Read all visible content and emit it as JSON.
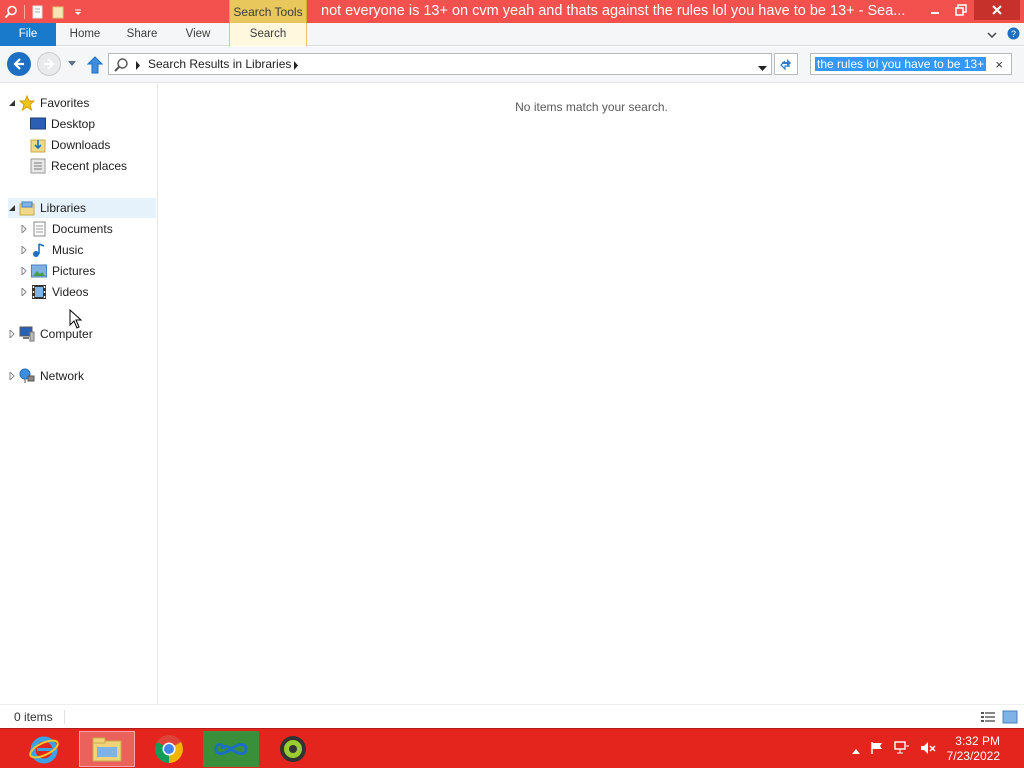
{
  "titlebar": {
    "title": "not everyone is 13+ on cvm yeah and thats against the rules lol you have to be 13+ - Sea...",
    "context_tab_group": "Search Tools"
  },
  "ribbon": {
    "tabs": [
      "File",
      "Home",
      "Share",
      "View",
      "Search"
    ],
    "active_tab": "Search"
  },
  "address": {
    "breadcrumb": "Search Results in Libraries"
  },
  "search": {
    "query": "the rules lol you have to be 13+"
  },
  "navpane": {
    "favorites": {
      "label": "Favorites",
      "items": [
        "Desktop",
        "Downloads",
        "Recent places"
      ]
    },
    "libraries": {
      "label": "Libraries",
      "items": [
        "Documents",
        "Music",
        "Pictures",
        "Videos"
      ]
    },
    "computer": "Computer",
    "network": "Network"
  },
  "main": {
    "empty_message": "No items match your search."
  },
  "statusbar": {
    "count": "0 items"
  },
  "taskbar": {
    "apps": [
      "internet-explorer-icon",
      "file-explorer-icon",
      "chrome-icon",
      "infinity-app-icon",
      "settings-gear-app-icon"
    ],
    "clock_time": "3:32 PM",
    "clock_date": "7/23/2022"
  },
  "colors": {
    "titlebar": "#f2514d",
    "taskbar": "#e3251d",
    "file_tab": "#1979ca",
    "search_tools": "#e8c85c",
    "selection": "#3399ff"
  }
}
